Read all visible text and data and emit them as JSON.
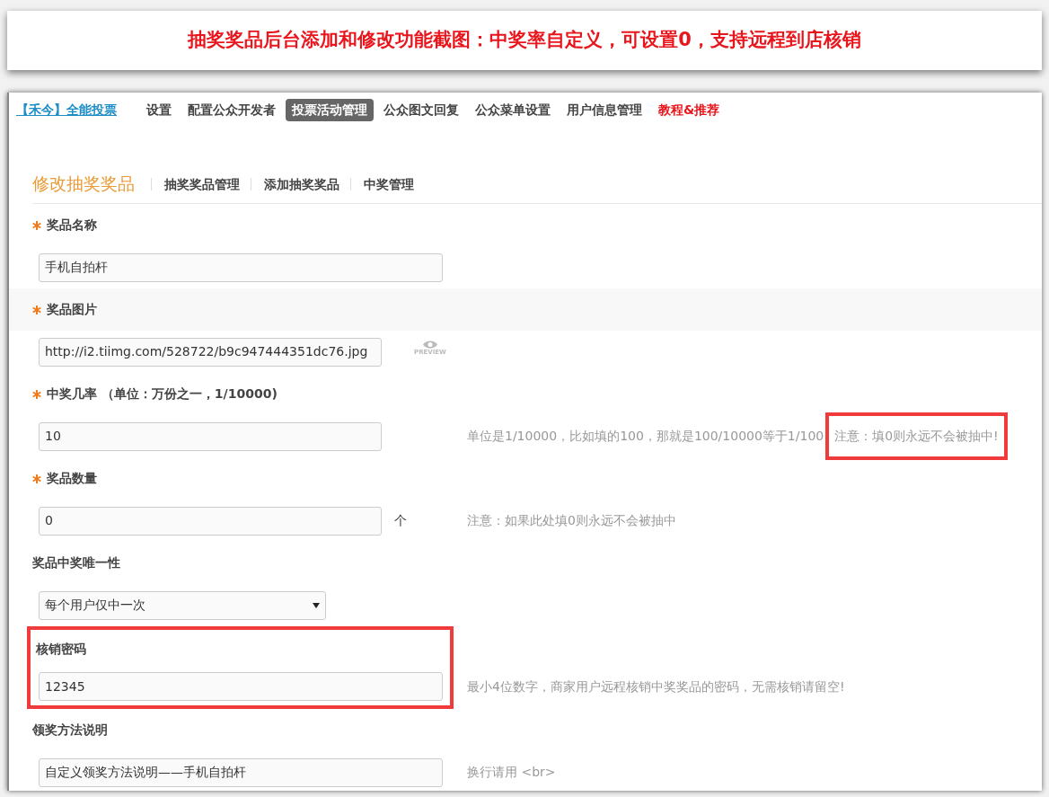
{
  "banner": {
    "text": "抽奖奖品后台添加和修改功能截图：中奖率自定义，可设置0，支持远程到店核销"
  },
  "nav": {
    "brand": "【禾今】全能投票",
    "items": [
      {
        "label": "设置",
        "selected": false,
        "kind": "normal"
      },
      {
        "label": "配置公众开发者",
        "selected": false,
        "kind": "normal"
      },
      {
        "label": "投票活动管理",
        "selected": true,
        "kind": "normal"
      },
      {
        "label": "公众图文回复",
        "selected": false,
        "kind": "normal"
      },
      {
        "label": "公众菜单设置",
        "selected": false,
        "kind": "normal"
      },
      {
        "label": "用户信息管理",
        "selected": false,
        "kind": "normal"
      },
      {
        "label": "教程&推荐",
        "selected": false,
        "kind": "promo"
      }
    ]
  },
  "page_header": {
    "title": "修改抽奖奖品",
    "links": [
      "抽奖奖品管理",
      "添加抽奖奖品",
      "中奖管理"
    ]
  },
  "fields": [
    {
      "kind": "text",
      "label": "奖品名称",
      "required": true,
      "shaded": false,
      "highlighted": false,
      "value": "手机自拍杆"
    },
    {
      "kind": "text",
      "label": "奖品图片",
      "required": true,
      "shaded": true,
      "highlighted": false,
      "value": "http://i2.tiimg.com/528722/b9c947444351dc76.jpg",
      "preview_label": "PREVIEW"
    },
    {
      "kind": "text",
      "label": "中奖几率 （单位：万份之一，1/10000)",
      "required": true,
      "shaded": false,
      "highlighted": false,
      "value": "10",
      "hint": "单位是1/10000，比如填的100，那就是100/10000等于1/100",
      "note": {
        "text": "注意：填0则永远不会被抽中!",
        "highlighted": true
      }
    },
    {
      "kind": "text",
      "label": "奖品数量",
      "required": true,
      "shaded": false,
      "highlighted": false,
      "value": "0",
      "suffix": "个",
      "hint": "注意：如果此处填0则永远不会被抽中"
    },
    {
      "kind": "select",
      "label": "奖品中奖唯一性",
      "required": false,
      "shaded": false,
      "highlighted": false,
      "value": "每个用户仅中一次"
    },
    {
      "kind": "text",
      "label": "核销密码",
      "required": false,
      "shaded": false,
      "highlighted": true,
      "value": "12345",
      "hint": "最小4位数字，商家用户远程核销中奖奖品的密码，无需核销请留空!"
    },
    {
      "kind": "text",
      "label": "领奖方法说明",
      "required": false,
      "shaded": false,
      "highlighted": false,
      "value": "自定义领奖方法说明——手机自拍杆",
      "hint": "换行请用 <br>"
    }
  ]
}
